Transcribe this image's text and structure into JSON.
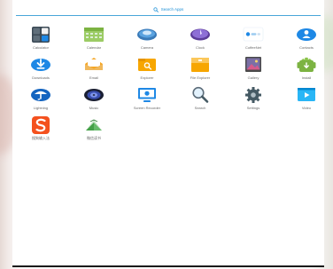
{
  "search": {
    "label": "Search Apps",
    "icon": "search-icon"
  },
  "apps": [
    {
      "label": "Calculator",
      "icon": "calculator-icon"
    },
    {
      "label": "Calendar",
      "icon": "calendar-icon"
    },
    {
      "label": "Camera",
      "icon": "camera-icon"
    },
    {
      "label": "Clock",
      "icon": "clock-icon"
    },
    {
      "label": "CoffeeNet",
      "icon": "coffeenet-icon"
    },
    {
      "label": "Contacts",
      "icon": "contacts-icon"
    },
    {
      "label": "Downloads",
      "icon": "downloads-icon"
    },
    {
      "label": "Email",
      "icon": "email-icon"
    },
    {
      "label": "Explorer",
      "icon": "explorer-icon"
    },
    {
      "label": "File Explorer",
      "icon": "file-explorer-icon"
    },
    {
      "label": "Gallery",
      "icon": "gallery-icon"
    },
    {
      "label": "Install",
      "icon": "install-icon"
    },
    {
      "label": "Lightning",
      "icon": "lightning-icon"
    },
    {
      "label": "Music",
      "icon": "music-icon"
    },
    {
      "label": "Screen Recorder",
      "icon": "screen-recorder-icon"
    },
    {
      "label": "Search",
      "icon": "search-app-icon"
    },
    {
      "label": "Settings",
      "icon": "settings-icon"
    },
    {
      "label": "Video",
      "icon": "video-icon"
    },
    {
      "label": "搜狗输入法",
      "icon": "sogou-input-icon"
    },
    {
      "label": "微信读书",
      "icon": "weread-icon"
    }
  ],
  "colors": {
    "accent": "#1b8fd6",
    "divider": "#49a6d9",
    "label": "#6a6a6a"
  }
}
